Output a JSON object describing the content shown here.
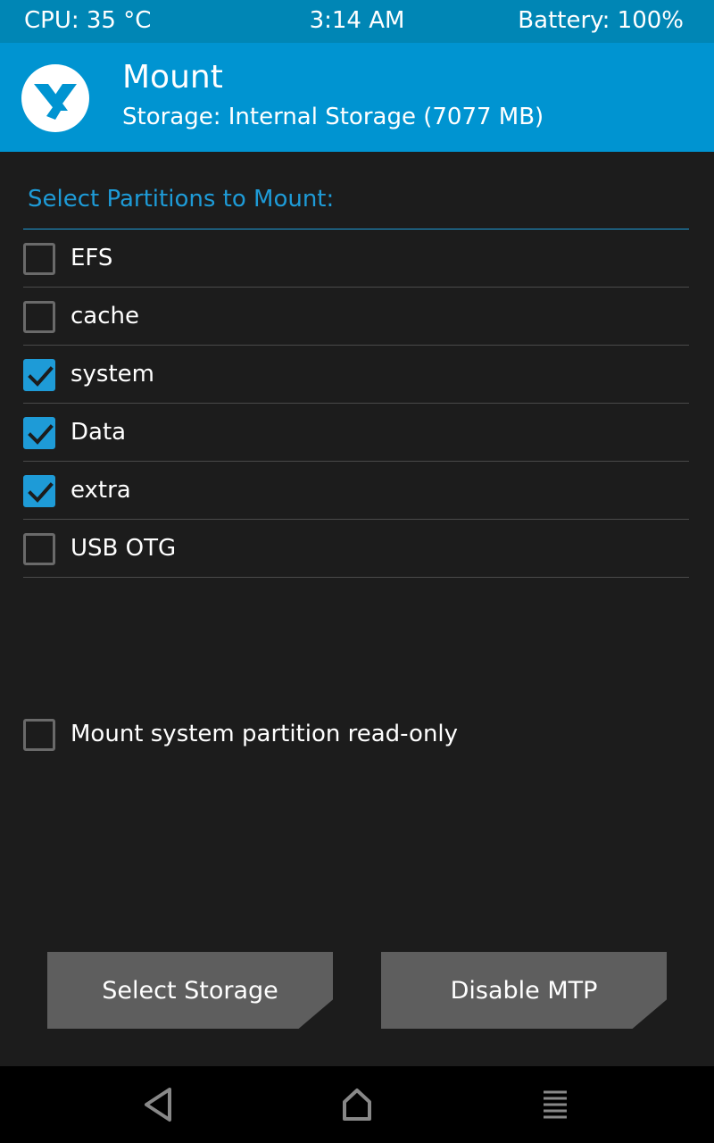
{
  "status": {
    "cpu": "CPU: 35 °C",
    "time": "3:14 AM",
    "battery": "Battery: 100%"
  },
  "header": {
    "title": "Mount",
    "subtitle": "Storage: Internal Storage (7077 MB)",
    "logo_icon": "twrp-logo-icon"
  },
  "section": {
    "title": "Select Partitions to Mount:"
  },
  "partitions": [
    {
      "label": "EFS",
      "checked": false
    },
    {
      "label": "cache",
      "checked": false
    },
    {
      "label": "system",
      "checked": true
    },
    {
      "label": "Data",
      "checked": true
    },
    {
      "label": "extra",
      "checked": true
    },
    {
      "label": "USB OTG",
      "checked": false
    }
  ],
  "readonly_option": {
    "label": "Mount system partition read-only",
    "checked": false
  },
  "buttons": {
    "select_storage": "Select Storage",
    "disable_mtp": "Disable MTP"
  },
  "nav": {
    "back_icon": "back-triangle-icon",
    "home_icon": "home-icon",
    "menu_icon": "menu-lines-icon"
  },
  "colors": {
    "status_bar": "#0086b5",
    "header": "#0094d1",
    "accent": "#1e9bd7",
    "background": "#1c1c1c",
    "button": "#5e5e5e"
  }
}
